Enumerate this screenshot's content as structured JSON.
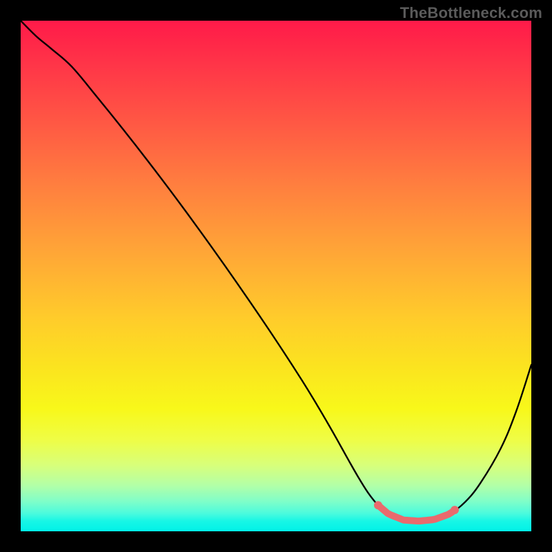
{
  "watermark": "TheBottleneck.com",
  "colors": {
    "curve": "#000000",
    "highlight": "#e96a6d",
    "gradient_top": "#ff1a49",
    "gradient_bottom": "#00f2e8"
  },
  "chart_data": {
    "type": "line",
    "title": "",
    "xlabel": "",
    "ylabel": "",
    "xlim": [
      0,
      100
    ],
    "ylim": [
      0,
      100
    ],
    "series": [
      {
        "name": "bottleneck-curve",
        "x": [
          0,
          3,
          6,
          10,
          15,
          20,
          25,
          30,
          35,
          40,
          45,
          50,
          55,
          58,
          60,
          62,
          64,
          66,
          68,
          70,
          72,
          75,
          78,
          81,
          84,
          87,
          90,
          94,
          97,
          100
        ],
        "values": [
          100,
          97,
          94.5,
          91,
          85,
          78.8,
          72.4,
          65.8,
          59,
          52,
          44.8,
          37.4,
          29.7,
          24.8,
          21.4,
          17.9,
          14.3,
          10.8,
          7.6,
          5.1,
          3.4,
          2.2,
          2.0,
          2.3,
          3.4,
          5.7,
          9.4,
          16.2,
          23.4,
          32.6
        ]
      }
    ],
    "highlight_range": {
      "x_start": 70,
      "x_end": 85
    }
  }
}
